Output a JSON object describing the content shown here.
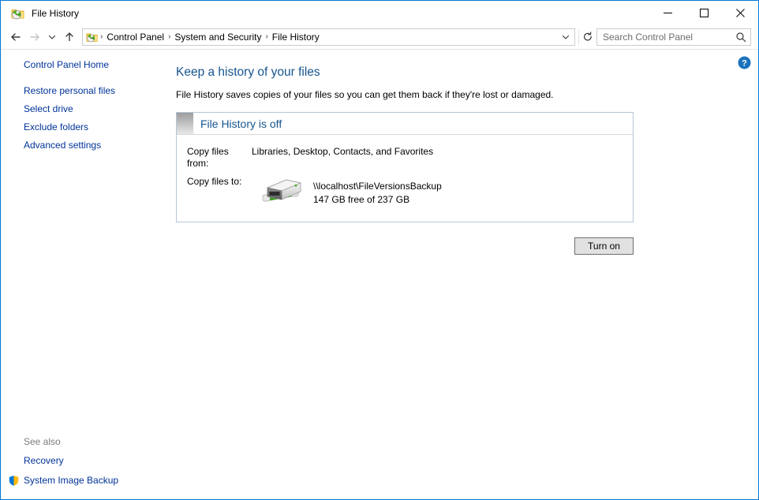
{
  "window": {
    "title": "File History",
    "icon": "file-history-icon",
    "minimize_label": "Minimize",
    "maximize_label": "Maximize",
    "close_label": "Close",
    "border_color": "#0078d7"
  },
  "toolbar": {
    "back_label": "Back",
    "forward_label": "Forward",
    "recent_label": "Recent locations",
    "up_label": "Up one level",
    "address_chevron_label": "Previous locations",
    "refresh_label": "Refresh"
  },
  "breadcrumb": {
    "icon": "control-panel-icon",
    "separator": "›",
    "items": [
      "Control Panel",
      "System and Security",
      "File History"
    ]
  },
  "search": {
    "placeholder": "Search Control Panel",
    "value": "",
    "icon": "search-icon"
  },
  "sidebar": {
    "home_label": "Control Panel Home",
    "items": [
      {
        "label": "Restore personal files"
      },
      {
        "label": "Select drive"
      },
      {
        "label": "Exclude folders"
      },
      {
        "label": "Advanced settings"
      }
    ],
    "see_also": {
      "title": "See also",
      "items": [
        {
          "label": "Recovery",
          "icon": ""
        },
        {
          "label": "System Image Backup",
          "icon": "shield-icon"
        }
      ]
    }
  },
  "main": {
    "help_label": "Help",
    "help_icon": "help-icon",
    "title": "Keep a history of your files",
    "description": "File History saves copies of your files so you can get them back if they're lost or damaged.",
    "status": {
      "heading": "File History is off",
      "copy_from_label": "Copy files from:",
      "copy_from_value": "Libraries, Desktop, Contacts, and Favorites",
      "copy_to_label": "Copy files to:",
      "drive_icon": "network-drive-icon",
      "drive_path": "\\\\localhost\\FileVersionsBackup",
      "drive_space": "147 GB free of 237 GB"
    },
    "turn_on_label": "Turn on"
  },
  "colors": {
    "link": "#003399",
    "heading": "#16558f",
    "accent": "#0078d7"
  }
}
